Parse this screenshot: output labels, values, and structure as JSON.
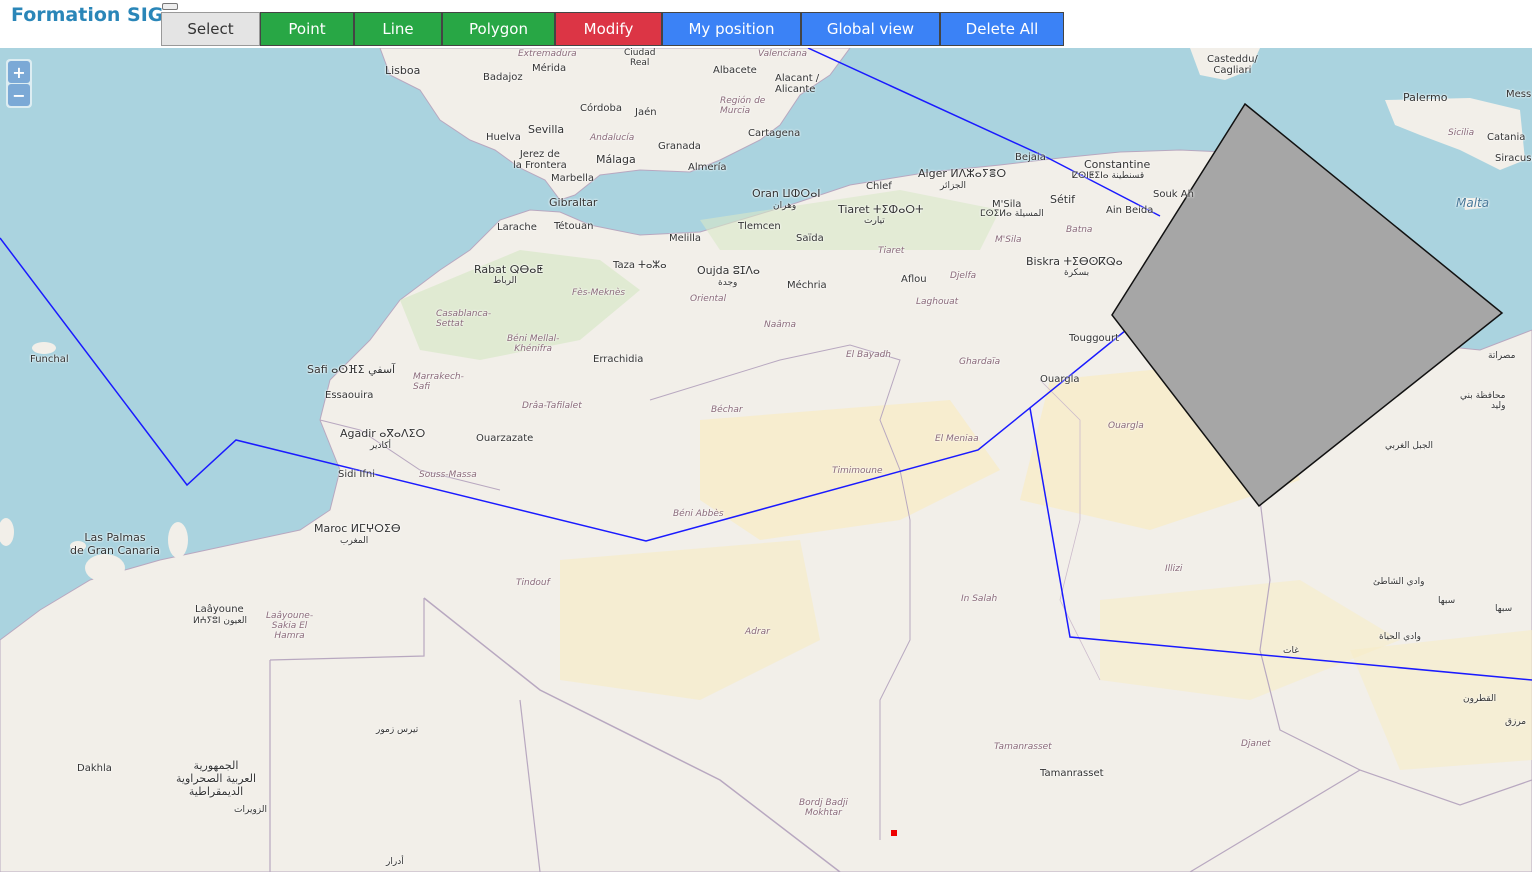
{
  "app": {
    "title": "Formation SIG"
  },
  "toolbar": {
    "select": "Select",
    "point": "Point",
    "line": "Line",
    "polygon": "Polygon",
    "modify": "Modify",
    "my_position": "My position",
    "global_view": "Global view",
    "delete_all": "Delete All"
  },
  "zoom": {
    "in": "+",
    "out": "−"
  },
  "colors": {
    "brand": "#2a86b8",
    "green": "#28a745",
    "red": "#dc3545",
    "blue": "#3b82f6",
    "line": "#1a1aff",
    "polygon_fill": "#a6a6a6"
  },
  "map_labels": {
    "lisboa": "Lisboa",
    "merida": "Mérida",
    "badajoz": "Badajoz",
    "albacete": "Albacete",
    "alacant": "Alacant /\nAlicante",
    "cordoba": "Córdoba",
    "jaen": "Jaén",
    "region_murcia": "Región de\nMurcia",
    "sevilla": "Sevilla",
    "huelva": "Huelva",
    "andalucia": "Andalucía",
    "cartagena": "Cartagena",
    "granada": "Granada",
    "jerez": "Jerez de\nla Frontera",
    "malaga": "Málaga",
    "almeria": "Almería",
    "marbella": "Marbella",
    "gibraltar": "Gibraltar",
    "oran": "Oran ⵡⵀⵔⴰⵏ",
    "wahran": "وهران",
    "chlef": "Chlef",
    "alger": "Alger ⵍⴷⵣⴰⵢⴻⵔ",
    "aljazair": "الجزائر",
    "bejaia": "Bejaia",
    "constantine": "Constantine",
    "constantine_ar": "ⵇⵙⵏⵟⵉⵏⴰ قسنطينة",
    "setif": "Sétif",
    "souk_ahras": "Souk Ah",
    "ain_beida": "Ain Beida",
    "tiaret": "Tiaret ⵜⵉⵀⴰⵔⵜ",
    "tiaret_ar": "تيارت",
    "msila": "M'Sila",
    "msila_ar": "ⵎⵙⵉⵍⴰ المسيلة",
    "msila_region": "M'Sila",
    "batna": "Batna",
    "larache": "Larache",
    "tetouan": "Tétouan",
    "melilla": "Melilla",
    "tlemcen": "Tlemcen",
    "saida": "Saïda",
    "tiaret_region": "Tiaret",
    "rabat": "Rabat ⵕⴱⴰⵟ",
    "rabat_ar": "الرباط",
    "taza": "Taza ⵜⴰⵣⴰ",
    "oujda": "Oujda ⵓⵊⴷⴰ",
    "oujda_ar": "وجدة",
    "mechria": "Méchria",
    "aflou": "Aflou",
    "djelfa": "Djelfa",
    "biskra": "Biskra ⵜⵉⴱⵙⴽⵕⴰ",
    "biskra_ar": "بسكرة",
    "fes_meknes": "Fès-Meknès",
    "casablanca": "Casablanca-\nSettat",
    "oriental": "Oriental",
    "naama": "Naâma",
    "laghouat": "Laghouat",
    "beni_mellal": "Béni Mellal-\nKhénifra",
    "errachidia": "Errachidia",
    "el_bayadh": "El Bayadh",
    "ghardaia": "Ghardaïa",
    "touggourt": "Touggourt",
    "safi": "Safi ⴰⵙⴼⵉ آسفي",
    "marrakech": "Marrakech-\nSafi",
    "essaouira": "Essaouira",
    "bechar": "Béchar",
    "ouargla": "Ouargla",
    "ouargla_region": "Ouargla",
    "agadir": "Agadir ⴰⴳⴰⴷⵉⵔ",
    "agadir_ar": "أكادير",
    "draa": "Drâa-Tafilalet",
    "ouarzazate": "Ouarzazate",
    "el_meniaa": "El Meniaa",
    "sidi_ifni": "Sidi Ifni",
    "souss": "Souss-Massa",
    "timimoune": "Timimoune",
    "beni_abbes": "Béni Abbès",
    "maroc": "Maroc ⵍⵎⵖⵔⵉⴱ",
    "maroc_ar": "المغرب",
    "las_palmas": "Las Palmas\nde Gran Canaria",
    "tindouf": "Tindouf",
    "laayoune": "Laâyoune",
    "laayoune_ar": "ⵍⵄⵢⵓⵏ العيون",
    "laayoune_region": "Laâyoune-\nSakia El\nHamra",
    "adrar_region": "Adrar",
    "in_salah": "In Salah",
    "illizi": "Illizi",
    "tamanrasset_region": "Tamanrasset",
    "tamanrasset": "Tamanrasset",
    "djanet": "Djanet",
    "dakhla": "Dakhla",
    "bordj": "Bordj Badji\nMokhtar",
    "rasd": "الجمهورية\nالعربية الصحراوية\nالديمقراطية",
    "funchal": "Funchal",
    "castedddu": "Casteddu/\nCagliari",
    "palermo": "Palermo",
    "messina": "Mess",
    "catania": "Catania",
    "siracusa": "Siracusa",
    "sicilia": "Sicilia",
    "malta": "Malta",
    "misrata": "مصراتة",
    "sebha": "سبها",
    "ghat": "غات",
    "qatrun": "القطرون",
    "murzuq": "مرزق",
    "zouerat": "الزويرات",
    "tiris": "تيرس زمور",
    "adrar_ar": "أدرار",
    "wadi_shati": "وادي الشاطئ",
    "wadi_hayat": "وادي الحياة",
    "jabal_gharbi": "الجبل الغربي",
    "bani_walid": "محافظة بني\nوليد",
    "valenciana": "Valenciana",
    "extremadura": "Extremadura",
    "ciudad_real": "Ciudad\nReal",
    "sebha2": "سبها"
  }
}
